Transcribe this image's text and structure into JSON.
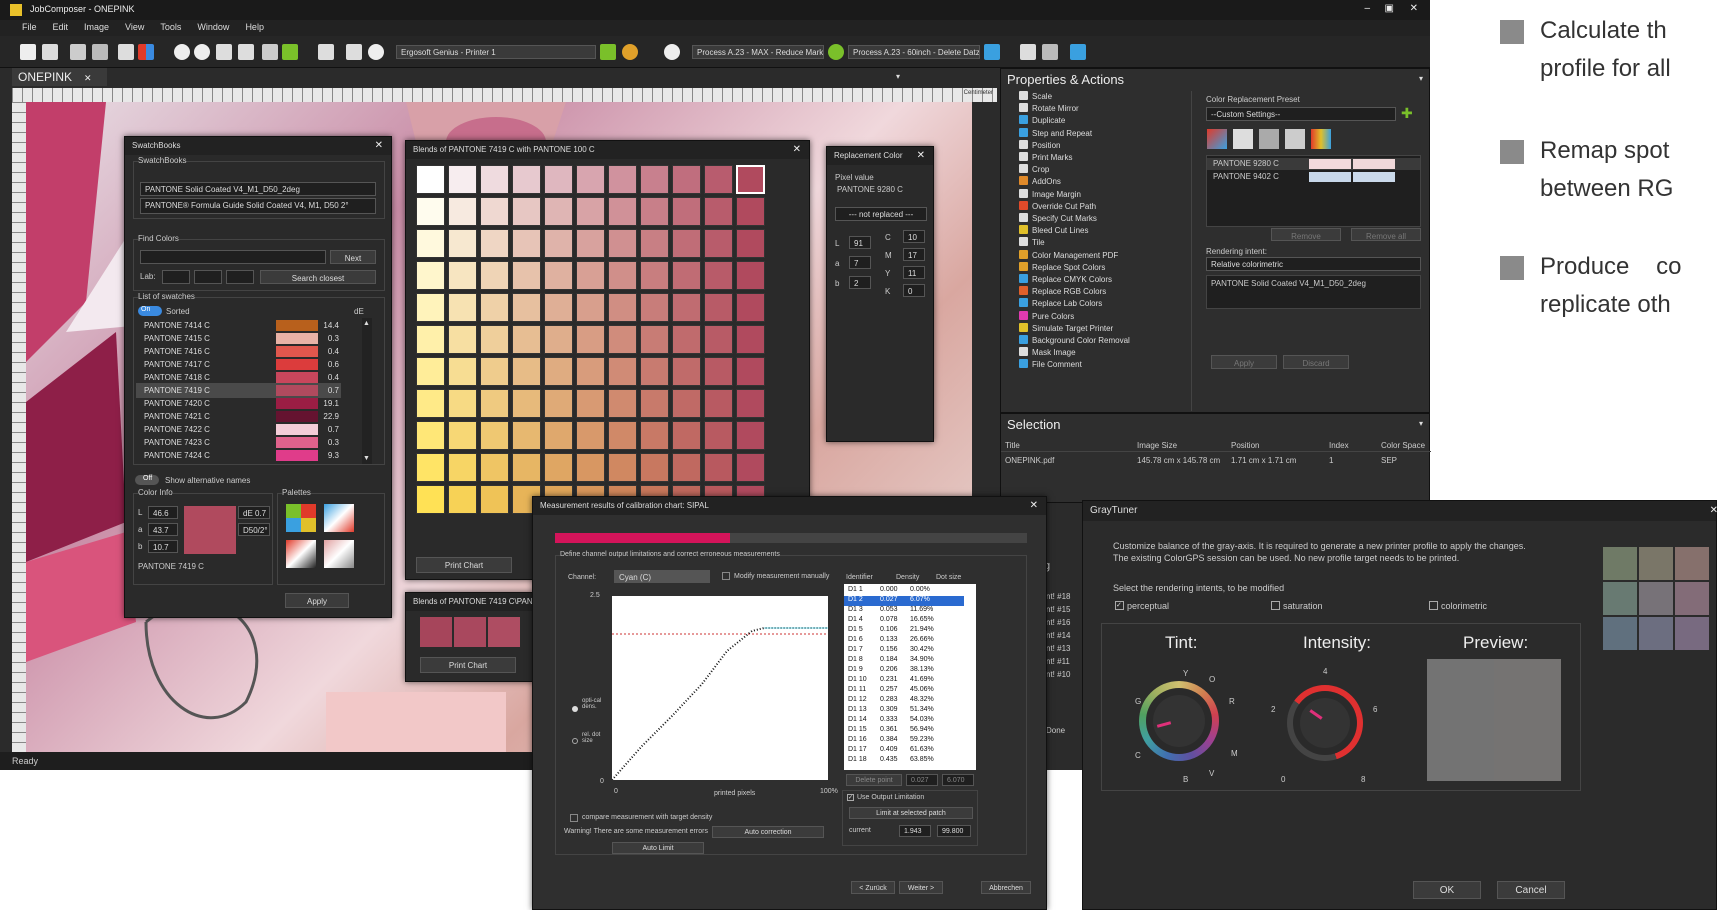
{
  "app": {
    "title": "JobComposer - ONEPINK",
    "menu": [
      "File",
      "Edit",
      "Image",
      "View",
      "Tools",
      "Window",
      "Help"
    ],
    "status": "Ready",
    "doc_tab": "ONEPINK"
  },
  "toolbar": {
    "printer": "Ergosoft Genius - Printer 1",
    "process1": "Process A.23 - MAX - Reduce Mark:",
    "process2": "Process A.23 - 60inch - Delete Datz"
  },
  "ruler": {
    "unit": "Centimeter"
  },
  "swatchbooks": {
    "title": "SwatchBooks",
    "group": "SwatchBooks",
    "book": "PANTONE Solid Coated V4_M1_D50_2deg",
    "book_desc": "PANTONE® Formula Guide Solid Coated V4, M1, D50 2°",
    "find_group": "Find Colors",
    "next": "Next",
    "lab_label": "Lab:",
    "search_closest": "Search closest",
    "list_group": "List of swatches",
    "toggle_on": "On",
    "sorted": "Sorted",
    "de_header": "dE",
    "swatches": [
      {
        "name": "PANTONE 7414 C",
        "color": "#b8601c",
        "de": "14.4"
      },
      {
        "name": "PANTONE 7415 C",
        "color": "#e8b2a6",
        "de": "0.3"
      },
      {
        "name": "PANTONE 7416 C",
        "color": "#e0574d",
        "de": "0.4"
      },
      {
        "name": "PANTONE 7417 C",
        "color": "#dc3c3c",
        "de": "0.6"
      },
      {
        "name": "PANTONE 7418 C",
        "color": "#c8465c",
        "de": "0.4"
      },
      {
        "name": "PANTONE 7419 C",
        "color": "#b04a5e",
        "de": "0.7"
      },
      {
        "name": "PANTONE 7420 C",
        "color": "#9b1d44",
        "de": "19.1"
      },
      {
        "name": "PANTONE 7421 C",
        "color": "#651330",
        "de": "22.9"
      },
      {
        "name": "PANTONE 7422 C",
        "color": "#f4cdd8",
        "de": "0.7"
      },
      {
        "name": "PANTONE 7423 C",
        "color": "#e0628c",
        "de": "0.3"
      },
      {
        "name": "PANTONE 7424 C",
        "color": "#e03c8a",
        "de": "9.3"
      }
    ],
    "toggle_off": "Off",
    "show_alt": "Show alternative names",
    "color_info": "Color Info",
    "palettes": "Palettes",
    "L": "46.6",
    "a": "43.7",
    "b": "10.7",
    "L_label": "L",
    "a_label": "a",
    "b_label": "b",
    "de_value": "dE 0.7",
    "illum": "D50/2°",
    "swatch_color": "#b04a5e",
    "swatch_name": "PANTONE 7419 C",
    "apply": "Apply"
  },
  "blends": {
    "title": "Blends of PANTONE 7419 C with PANTONE 100 C",
    "print_chart": "Print Chart",
    "title2": "Blends of PANTONE 7419 C\\PAN",
    "print_chart2": "Print Chart"
  },
  "replacement": {
    "title": "Replacement Color",
    "pixel_label": "Pixel value",
    "pixel_value": "PANTONE 9280 C",
    "not_replaced": "--- not replaced ---",
    "L": "91",
    "a": "7",
    "b": "2",
    "C": "10",
    "M": "17",
    "Y": "11",
    "K": "0",
    "L_label": "L",
    "a_label": "a",
    "b_label": "b",
    "C_label": "C",
    "M_label": "M",
    "Y_label": "Y",
    "K_label": "K"
  },
  "properties": {
    "title": "Properties & Actions",
    "actions": [
      {
        "label": "Scale",
        "color": "#ddd"
      },
      {
        "label": "Rotate Mirror",
        "color": "#ddd"
      },
      {
        "label": "Duplicate",
        "color": "#3aa0e0"
      },
      {
        "label": "Step and Repeat",
        "color": "#3aa0e0"
      },
      {
        "label": "Position",
        "color": "#ddd"
      },
      {
        "label": "Print Marks",
        "color": "#ddd"
      },
      {
        "label": "Crop",
        "color": "#ddd"
      },
      {
        "label": "AddOns",
        "color": "#e08a2a"
      },
      {
        "label": "Image Margin",
        "color": "#ddd"
      },
      {
        "label": "Override Cut Path",
        "color": "#e04a2a"
      },
      {
        "label": "Specify Cut Marks",
        "color": "#ddd"
      },
      {
        "label": "Bleed Cut Lines",
        "color": "#e0c02a"
      },
      {
        "label": "Tile",
        "color": "#ddd"
      },
      {
        "label": "Color Management PDF",
        "color": "#e0a02a"
      },
      {
        "label": "Replace Spot Colors",
        "color": "#e0a02a"
      },
      {
        "label": "Replace CMYK Colors",
        "color": "#3aa0e0"
      },
      {
        "label": "Replace RGB Colors",
        "color": "#e0602a"
      },
      {
        "label": "Replace Lab Colors",
        "color": "#3aa0e0"
      },
      {
        "label": "Pure Colors",
        "color": "#e03ab0"
      },
      {
        "label": "Simulate Target Printer",
        "color": "#e0c02a"
      },
      {
        "label": "Background Color Removal",
        "color": "#3aa0e0"
      },
      {
        "label": "Mask Image",
        "color": "#ddd"
      },
      {
        "label": "File Comment",
        "color": "#3aa0e0"
      }
    ],
    "preset_label": "Color Replacement Preset",
    "preset": "--Custom Settings--",
    "replacements": [
      {
        "name": "PANTONE 9280 C",
        "c1": "#f2d9dc",
        "c2": "#f0d8da"
      },
      {
        "name": "PANTONE 9402 C",
        "c1": "#c8d8ea",
        "c2": "#cad9ea"
      }
    ],
    "remove": "Remove",
    "remove_all": "Remove all",
    "intent_label": "Rendering intent:",
    "intent": "Relative colorimetric",
    "profile_item": "PANTONE Solid Coated V4_M1_D50_2deg",
    "apply": "Apply",
    "discard": "Discard"
  },
  "selection": {
    "title": "Selection",
    "headers": [
      "Title",
      "Image Size",
      "Position",
      "Index",
      "Color Space"
    ],
    "row": [
      "ONEPINK.pdf",
      "145.78 cm x 145.78 cm",
      "1.71 cm x 1.71 cm",
      "1",
      "SEP"
    ]
  },
  "jobs": {
    "items": [
      "nt! #18",
      "nt! #15",
      "nt! #16",
      "nt! #14",
      "nt! #13",
      "nt! #11",
      "nt! #10"
    ],
    "done": "Done",
    "g": "g"
  },
  "measure": {
    "title": "Measurement results of calibration chart: SIPAL",
    "group": "Define channel output limitations and correct erroneous measurements",
    "channel_label": "Channel:",
    "channel": "Cyan (C)",
    "modify": "Modify measurement manually",
    "y_max": "2.5",
    "y_min": "0",
    "x_min": "0",
    "x_max": "100%",
    "x_label": "printed pixels",
    "opt_dens": "opti-cal dens.",
    "rel_dot": "rel. dot size",
    "compare": "compare measurement with target density",
    "warning": "Warning! There are some measurement errors",
    "auto_correction": "Auto correction",
    "auto_limit": "Auto Limit",
    "col_id": "Identifier",
    "col_density": "Density",
    "col_dot": "Dot size",
    "rows": [
      {
        "id": "D1 1",
        "density": "0.000",
        "dot": "0.00%"
      },
      {
        "id": "D1 2",
        "density": "0.027",
        "dot": "6.07%"
      },
      {
        "id": "D1 3",
        "density": "0.053",
        "dot": "11.69%"
      },
      {
        "id": "D1 4",
        "density": "0.078",
        "dot": "16.65%"
      },
      {
        "id": "D1 5",
        "density": "0.106",
        "dot": "21.94%"
      },
      {
        "id": "D1 6",
        "density": "0.133",
        "dot": "26.66%"
      },
      {
        "id": "D1 7",
        "density": "0.156",
        "dot": "30.42%"
      },
      {
        "id": "D1 8",
        "density": "0.184",
        "dot": "34.90%"
      },
      {
        "id": "D1 9",
        "density": "0.206",
        "dot": "38.13%"
      },
      {
        "id": "D1 10",
        "density": "0.231",
        "dot": "41.69%"
      },
      {
        "id": "D1 11",
        "density": "0.257",
        "dot": "45.06%"
      },
      {
        "id": "D1 12",
        "density": "0.283",
        "dot": "48.32%"
      },
      {
        "id": "D1 13",
        "density": "0.309",
        "dot": "51.34%"
      },
      {
        "id": "D1 14",
        "density": "0.333",
        "dot": "54.03%"
      },
      {
        "id": "D1 15",
        "density": "0.361",
        "dot": "56.94%"
      },
      {
        "id": "D1 16",
        "density": "0.384",
        "dot": "59.23%"
      },
      {
        "id": "D1 17",
        "density": "0.409",
        "dot": "61.63%"
      },
      {
        "id": "D1 18",
        "density": "0.435",
        "dot": "63.85%"
      }
    ],
    "delete_point": "Delete point",
    "dp1": "0.027",
    "dp2": "6.070",
    "use_output": "Use Output Limitation",
    "limit_patch": "Limit at selected patch",
    "current_label": "current",
    "current1": "1.943",
    "current2": "99.800",
    "back": "< Zurück",
    "next": "Weiter >",
    "cancel": "Abbrechen"
  },
  "graytuner": {
    "title": "GrayTuner",
    "desc1": "Customize balance of the gray-axis. It is required to generate a new printer profile to apply the changes.",
    "desc2": "The existing ColorGPS session can be used. No new profile target needs to be printed.",
    "select": "Select the rendering intents, to be modified",
    "perceptual": "perceptual",
    "saturation": "saturation",
    "colorimetric": "colorimetric",
    "tint": "Tint:",
    "intensity": "Intensity:",
    "preview": "Preview:",
    "dial_tint": {
      "Y": "Y",
      "O": "O",
      "R": "R",
      "M": "M",
      "V": "V",
      "B": "B",
      "C": "C",
      "G": "G"
    },
    "dial_int": {
      "zero": "0",
      "two": "2",
      "four": "4",
      "six": "6",
      "eight": "8"
    },
    "ok": "OK",
    "cancel": "Cancel",
    "grid": [
      "#6f7a66",
      "#7a7668",
      "#86706c",
      "#687a72",
      "#777278",
      "#836c78",
      "#60707e",
      "#6c6e80",
      "#786a80"
    ]
  },
  "bullets": [
    {
      "line1": "Calculate th",
      "line2": "profile for all"
    },
    {
      "line1": "Remap spot",
      "line2": "between RG"
    },
    {
      "line1": "Produce    co",
      "line2": "replicate oth"
    }
  ]
}
